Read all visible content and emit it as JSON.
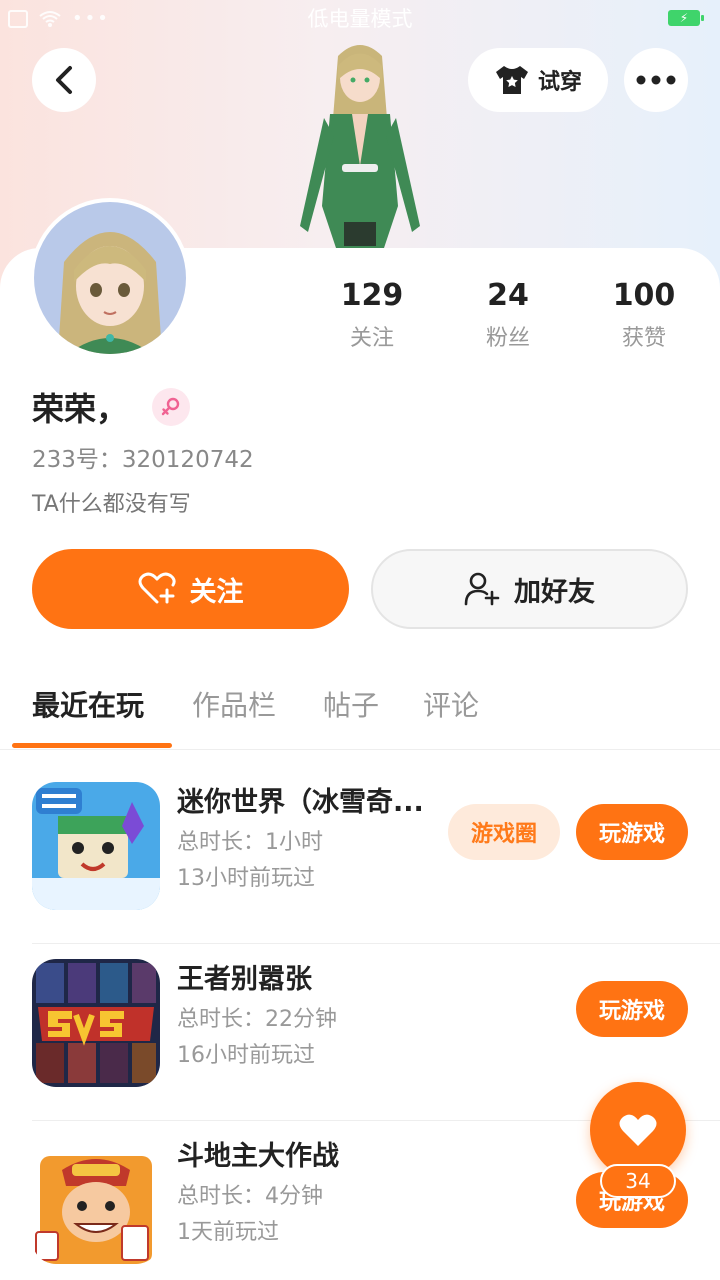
{
  "status_bar": {
    "center_text": "低电量模式"
  },
  "header": {
    "tryon_label": "试穿",
    "icons": {
      "back": "chevron-left-icon",
      "more": "more-dots-icon",
      "tryon": "tshirt-icon"
    }
  },
  "profile": {
    "name": "荣荣，",
    "uid": "233号：320120742",
    "bio": "TA什么都没有写",
    "gender_icon": "female-icon"
  },
  "stats": [
    {
      "value": "129",
      "label": "关注"
    },
    {
      "value": "24",
      "label": "粉丝"
    },
    {
      "value": "100",
      "label": "获赞"
    }
  ],
  "actions": {
    "follow_label": "关注",
    "add_friend_label": "加好友"
  },
  "tabs": [
    {
      "label": "最近在玩",
      "active": true
    },
    {
      "label": "作品栏",
      "active": false
    },
    {
      "label": "帖子",
      "active": false
    },
    {
      "label": "评论",
      "active": false
    }
  ],
  "games": [
    {
      "title": "迷你世界（冰雪奇...",
      "duration": "总时长：1小时",
      "last_played": "13小时前玩过",
      "circle_label": "游戏圈",
      "play_label": "玩游戏",
      "icon": "mini-world-icon"
    },
    {
      "title": "王者别嚣张",
      "duration": "总时长：22分钟",
      "last_played": "16小时前玩过",
      "play_label": "玩游戏",
      "icon": "5v5-game-icon"
    },
    {
      "title": "斗地主大作战",
      "duration": "总时长：4分钟",
      "last_played": "1天前玩过",
      "play_label": "玩游戏",
      "icon": "doudizhu-icon"
    }
  ],
  "fab": {
    "count": "34",
    "icon": "heart-icon"
  },
  "colors": {
    "accent": "#ff7313",
    "accent_light": "#feeadb",
    "text_muted": "#999999"
  }
}
